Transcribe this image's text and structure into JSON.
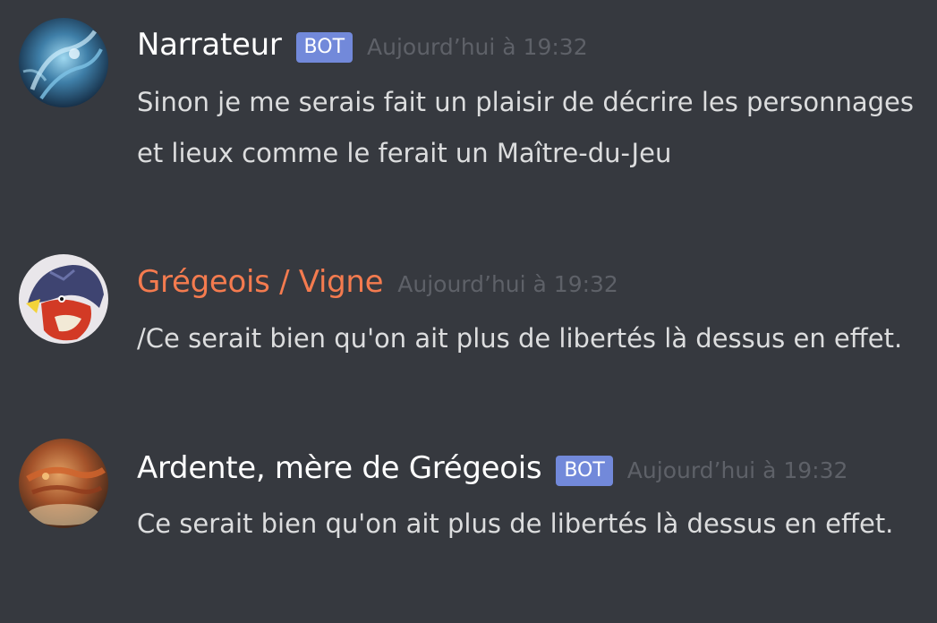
{
  "messages": [
    {
      "author": "Narrateur",
      "bot_label": "BOT",
      "timestamp": "Aujourd’hui à 19:32",
      "text": "Sinon je me serais fait un plaisir de décrire les personnages et lieux comme le ferait un Maître-du-Jeu",
      "name_color": "#ffffff"
    },
    {
      "author": "Grégeois / Vigne",
      "timestamp": "Aujourd’hui à 19:32",
      "text": "/Ce serait bien qu'on ait plus de libertés là dessus en effet.",
      "name_color": "#f47b4f"
    },
    {
      "author": "Ardente, mère de Grégeois",
      "bot_label": "BOT",
      "timestamp": "Aujourd’hui à 19:32",
      "text": "Ce serait bien qu'on ait plus de libertés là dessus en effet.",
      "name_color": "#ffffff"
    }
  ],
  "colors": {
    "background": "#36393f",
    "bot_tag": "#7289da",
    "timestamp": "#5e6168",
    "text": "#dcddde"
  }
}
